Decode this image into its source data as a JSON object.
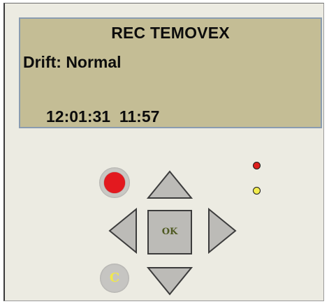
{
  "display": {
    "title": "REC TEMOVEX",
    "line1": "Drift: Normal",
    "line2": "12:01:31  11:57"
  },
  "controls": {
    "record_button": {
      "icon": "record-dot",
      "color": "#e3191f"
    },
    "clear_button": {
      "label": "C",
      "color": "#f1e94a"
    },
    "ok_button": {
      "label": "OK"
    },
    "up_button": {
      "icon": "arrow-up"
    },
    "down_button": {
      "icon": "arrow-down"
    },
    "left_button": {
      "icon": "arrow-left"
    },
    "right_button": {
      "icon": "arrow-right"
    }
  },
  "indicators": {
    "red_led": {
      "color": "#dd1f1c"
    },
    "yellow_led": {
      "color": "#f2ec4e"
    }
  },
  "colors": {
    "panel": "#ecebe2",
    "lcd_background": "#c4bd95",
    "lcd_border": "#8a9cb0",
    "button_gray": "#bcbbb7"
  }
}
